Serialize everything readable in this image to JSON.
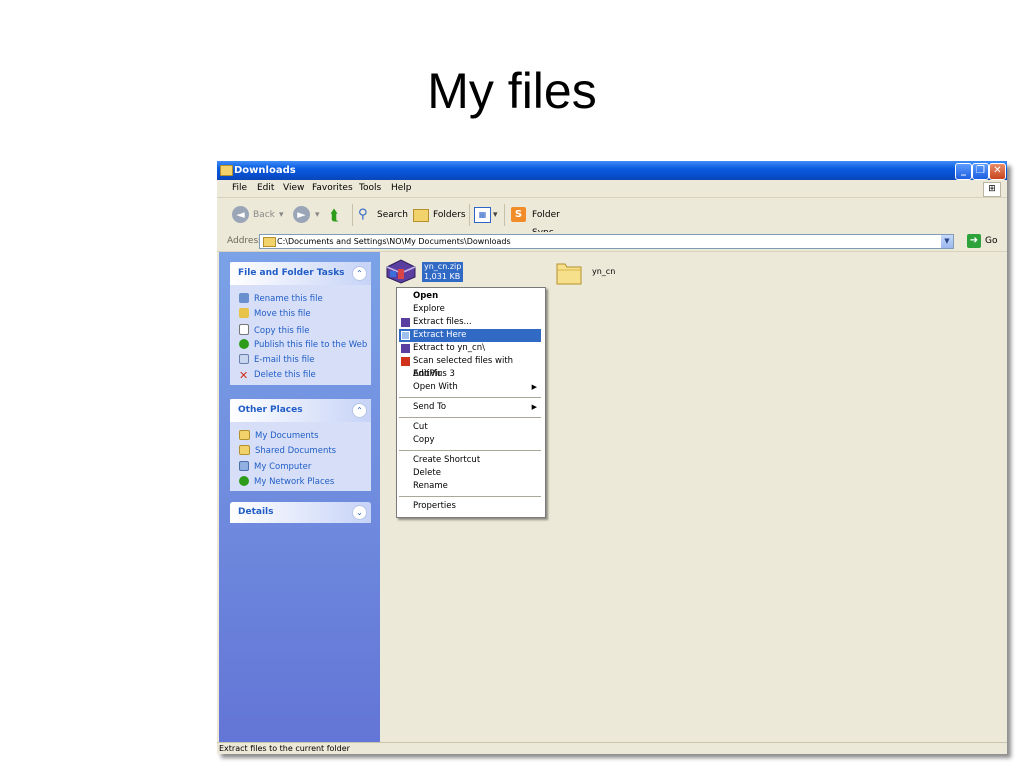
{
  "slide": {
    "title": "My files"
  },
  "window": {
    "title": "Downloads",
    "controls": {
      "minimize": "_",
      "maximize": "❐",
      "close": "✕"
    }
  },
  "menu": [
    "File",
    "Edit",
    "View",
    "Favorites",
    "Tools",
    "Help"
  ],
  "toolbar": {
    "back": "Back",
    "search": "Search",
    "folders": "Folders",
    "folder_sync": "Folder Sync"
  },
  "address": {
    "label": "Address",
    "path": "C:\\Documents and Settings\\NO\\My Documents\\Downloads",
    "go": "Go"
  },
  "left_pane": {
    "file_tasks": {
      "title": "File and Folder Tasks",
      "items": [
        "Rename this file",
        "Move this file",
        "Copy this file",
        "Publish this file to the Web",
        "E-mail this file",
        "Delete this file"
      ]
    },
    "other_places": {
      "title": "Other Places",
      "items": [
        "My Documents",
        "Shared Documents",
        "My Computer",
        "My Network Places"
      ]
    },
    "details": {
      "title": "Details"
    }
  },
  "files": [
    {
      "name": "yn_cn.zip",
      "size": "1,031 KB",
      "selected": true
    },
    {
      "name": "yn_cn",
      "type": "folder"
    }
  ],
  "context_menu": {
    "items": [
      "Open",
      "Explore",
      "Extract files...",
      "Extract Here",
      "Extract to yn_cn\\",
      "Scan selected files with AntiVir",
      "EditPlus 3",
      "Open With",
      "Send To",
      "Cut",
      "Copy",
      "Create Shortcut",
      "Delete",
      "Rename",
      "Properties"
    ],
    "highlighted": "Extract Here"
  },
  "status_bar": {
    "text": "Extract files to the current folder"
  },
  "colors": {
    "titlebar": "#0A5BE0",
    "selection": "#316AC5",
    "task_link": "#215DC6",
    "left_pane": "#7BA2E7"
  }
}
